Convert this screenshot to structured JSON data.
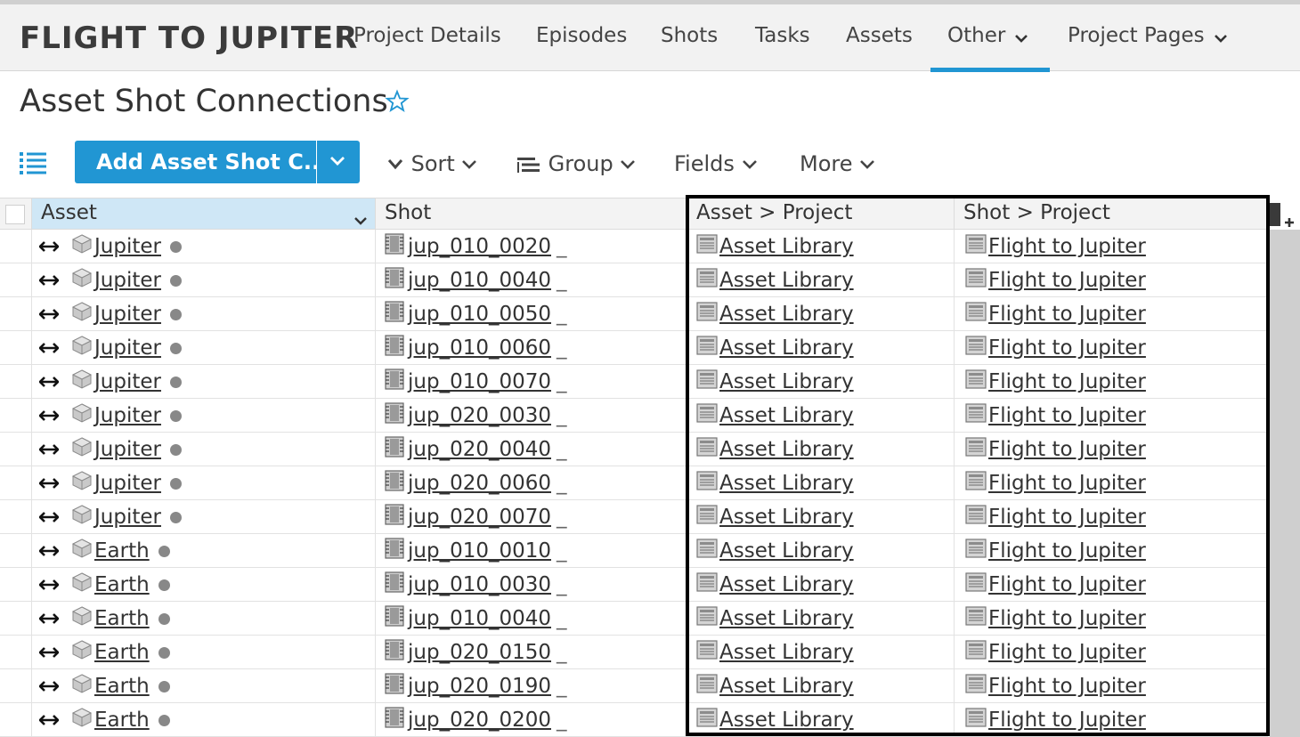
{
  "app": {
    "project_title": "FLIGHT TO JUPITER"
  },
  "nav": {
    "items": [
      {
        "label": "Project Details"
      },
      {
        "label": "Episodes"
      },
      {
        "label": "Shots"
      },
      {
        "label": "Tasks"
      },
      {
        "label": "Assets"
      },
      {
        "label": "Other",
        "active": true
      },
      {
        "label": "Project Pages"
      }
    ]
  },
  "page": {
    "title": "Asset Shot Connections"
  },
  "toolbar": {
    "add_label": "Add Asset Shot C...",
    "sort_label": "Sort",
    "group_label": "Group",
    "fields_label": "Fields",
    "more_label": "More"
  },
  "table": {
    "columns": [
      "Asset",
      "Shot",
      "Asset > Project",
      "Shot > Project"
    ],
    "rows": [
      {
        "asset": "Jupiter",
        "shot": "jup_010_0020",
        "asset_project": "Asset Library",
        "shot_project": "Flight to Jupiter"
      },
      {
        "asset": "Jupiter",
        "shot": "jup_010_0040",
        "asset_project": "Asset Library",
        "shot_project": "Flight to Jupiter"
      },
      {
        "asset": "Jupiter",
        "shot": "jup_010_0050",
        "asset_project": "Asset Library",
        "shot_project": "Flight to Jupiter"
      },
      {
        "asset": "Jupiter",
        "shot": "jup_010_0060",
        "asset_project": "Asset Library",
        "shot_project": "Flight to Jupiter"
      },
      {
        "asset": "Jupiter",
        "shot": "jup_010_0070",
        "asset_project": "Asset Library",
        "shot_project": "Flight to Jupiter"
      },
      {
        "asset": "Jupiter",
        "shot": "jup_020_0030",
        "asset_project": "Asset Library",
        "shot_project": "Flight to Jupiter"
      },
      {
        "asset": "Jupiter",
        "shot": "jup_020_0040",
        "asset_project": "Asset Library",
        "shot_project": "Flight to Jupiter"
      },
      {
        "asset": "Jupiter",
        "shot": "jup_020_0060",
        "asset_project": "Asset Library",
        "shot_project": "Flight to Jupiter"
      },
      {
        "asset": "Jupiter",
        "shot": "jup_020_0070",
        "asset_project": "Asset Library",
        "shot_project": "Flight to Jupiter"
      },
      {
        "asset": "Earth",
        "shot": "jup_010_0010",
        "asset_project": "Asset Library",
        "shot_project": "Flight to Jupiter"
      },
      {
        "asset": "Earth",
        "shot": "jup_010_0030",
        "asset_project": "Asset Library",
        "shot_project": "Flight to Jupiter"
      },
      {
        "asset": "Earth",
        "shot": "jup_010_0040",
        "asset_project": "Asset Library",
        "shot_project": "Flight to Jupiter"
      },
      {
        "asset": "Earth",
        "shot": "jup_020_0150",
        "asset_project": "Asset Library",
        "shot_project": "Flight to Jupiter"
      },
      {
        "asset": "Earth",
        "shot": "jup_020_0190",
        "asset_project": "Asset Library",
        "shot_project": "Flight to Jupiter"
      },
      {
        "asset": "Earth",
        "shot": "jup_020_0200",
        "asset_project": "Asset Library",
        "shot_project": "Flight to Jupiter"
      }
    ]
  },
  "colors": {
    "accent": "#2196d3",
    "sorted_header": "#cfe7f6",
    "status_dot": "#888888"
  },
  "icons": [
    "star-icon",
    "list-view-icon",
    "chevron-down-icon",
    "group-icon",
    "link-arrows-icon",
    "asset-cube-icon",
    "shot-film-icon",
    "project-page-icon",
    "add-column-icon"
  ]
}
